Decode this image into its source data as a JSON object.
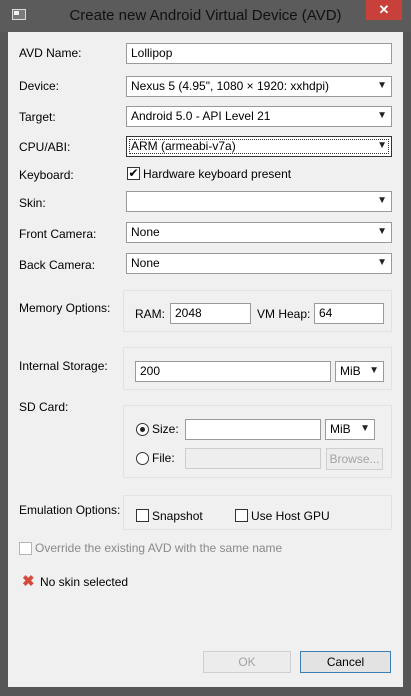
{
  "window": {
    "title": "Create new Android Virtual Device (AVD)",
    "close_glyph": "✕"
  },
  "avd_name": {
    "label": "AVD Name:",
    "value": "Lollipop"
  },
  "device": {
    "label": "Device:",
    "value": "Nexus 5 (4.95\", 1080 × 1920: xxhdpi)"
  },
  "target": {
    "label": "Target:",
    "value": "Android 5.0 - API Level 21"
  },
  "cpu_abi": {
    "label": "CPU/ABI:",
    "value": "ARM (armeabi-v7a)"
  },
  "keyboard": {
    "label": "Keyboard:",
    "checkbox_label": "Hardware keyboard present",
    "checked": true
  },
  "skin": {
    "label": "Skin:",
    "value": ""
  },
  "front_camera": {
    "label": "Front Camera:",
    "value": "None"
  },
  "back_camera": {
    "label": "Back Camera:",
    "value": "None"
  },
  "memory": {
    "label": "Memory Options:",
    "ram_label": "RAM:",
    "ram_value": "2048",
    "vm_heap_label": "VM Heap:",
    "vm_heap_value": "64"
  },
  "internal_storage": {
    "label": "Internal Storage:",
    "value": "200",
    "unit": "MiB"
  },
  "sd_card": {
    "label": "SD Card:",
    "size_label": "Size:",
    "size_value": "",
    "size_unit": "MiB",
    "file_label": "File:",
    "file_value": "",
    "browse_label": "Browse...",
    "selected": "size"
  },
  "emulation": {
    "label": "Emulation Options:",
    "snapshot_label": "Snapshot",
    "snapshot_checked": false,
    "host_gpu_label": "Use Host GPU",
    "host_gpu_checked": false
  },
  "override": {
    "label": "Override the existing AVD with the same name",
    "checked": false,
    "enabled": false
  },
  "status": {
    "message": "No skin selected",
    "icon": "error-x-icon"
  },
  "buttons": {
    "ok_label": "OK",
    "cancel_label": "Cancel"
  },
  "glyphs": {
    "dropdown_arrow": "▼",
    "check_mark": "✔",
    "error_x": "✖"
  },
  "colors": {
    "frame": "#565656",
    "client_bg": "#f0f0f0",
    "close_button": "#c7403a",
    "error_icon": "#d54a3c"
  }
}
